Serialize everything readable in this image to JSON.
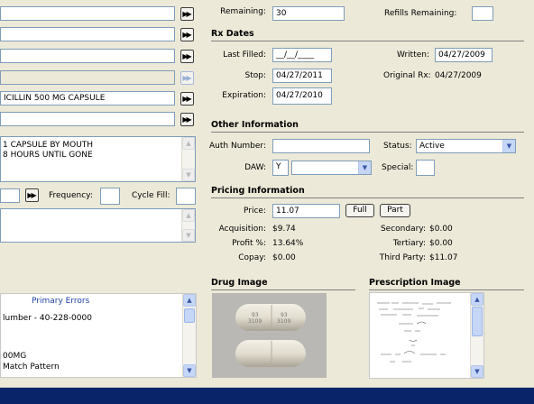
{
  "left": {
    "rows": [
      "",
      "",
      "",
      "",
      "ICILLIN 500 MG CAPSULE",
      ""
    ],
    "ff": "▶▶",
    "sig_lines": [
      "1 CAPSULE BY MOUTH",
      "8 HOURS UNTIL GONE"
    ],
    "frequency_label": "Frequency:",
    "frequency_value": "",
    "cycle_fill_label": "Cycle Fill:",
    "cycle_fill_value": "",
    "errors_header": "Primary Errors",
    "errors": [
      "lumber - 40-228-0000",
      "",
      "",
      "00MG",
      "Match Pattern"
    ]
  },
  "top": {
    "remaining_label": "Remaining:",
    "remaining_value": "30",
    "refills_label": "Refills Remaining:",
    "refills_value": ""
  },
  "rx_dates": {
    "title": "Rx Dates",
    "last_filled_label": "Last Filled:",
    "last_filled_value": "__/__/____",
    "written_label": "Written:",
    "written_value": "04/27/2009",
    "stop_label": "Stop:",
    "stop_value": "04/27/2011",
    "original_rx_label": "Original Rx:",
    "original_rx_value": "04/27/2009",
    "expiration_label": "Expiration:",
    "expiration_value": "04/27/2010"
  },
  "other": {
    "title": "Other Information",
    "auth_label": "Auth Number:",
    "auth_value": "",
    "status_label": "Status:",
    "status_value": "Active",
    "daw_label": "DAW:",
    "daw_value": "Y",
    "daw_desc": "",
    "special_label": "Special:",
    "special_value": ""
  },
  "pricing": {
    "title": "Pricing Information",
    "price_label": "Price:",
    "price_value": "11.07",
    "full_label": "Full",
    "part_label": "Part",
    "acq_label": "Acquisition:",
    "acq_value": "$9.74",
    "profit_label": "Profit %:",
    "profit_value": "13.64%",
    "copay_label": "Copay:",
    "copay_value": "$0.00",
    "secondary_label": "Secondary:",
    "secondary_value": "$0.00",
    "tertiary_label": "Tertiary:",
    "tertiary_value": "$0.00",
    "third_party_label": "Third Party:",
    "third_party_value": "$11.07"
  },
  "images": {
    "drug_title": "Drug Image",
    "rx_title": "Prescription Image",
    "capsule_imprint_left": "93\n3109",
    "capsule_imprint_right": "93\n3109"
  },
  "colors": {
    "background": "#ece9d8",
    "field_border": "#7f9db9",
    "link_blue": "#1f3fa6",
    "status_bar": "#0a246a"
  }
}
